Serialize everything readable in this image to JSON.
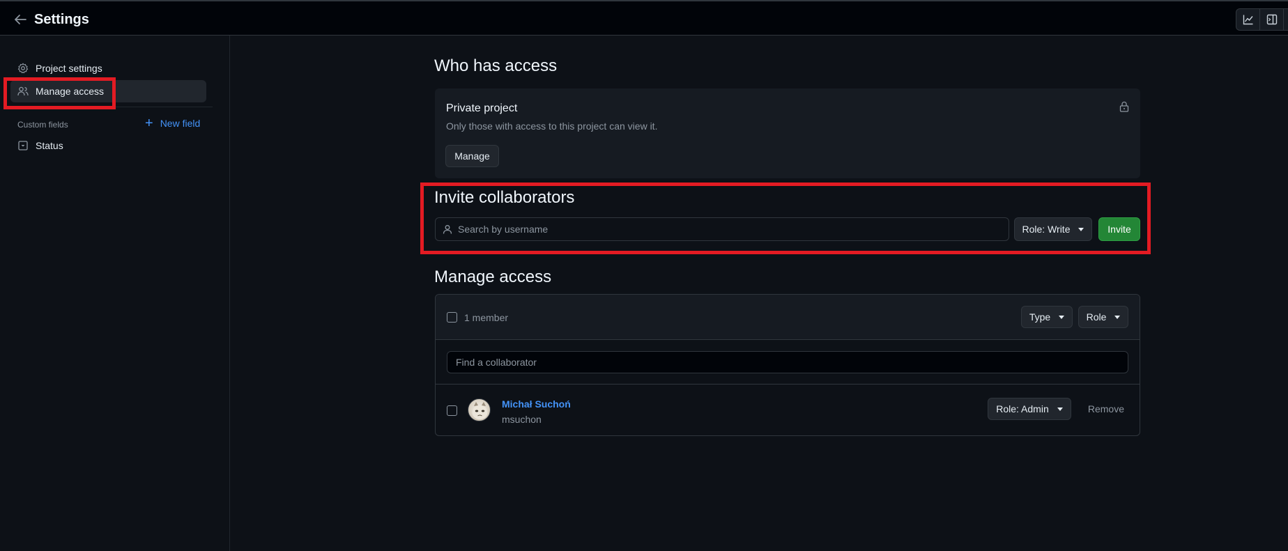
{
  "header": {
    "title": "Settings",
    "back_icon": "arrow-left-icon",
    "actions": [
      {
        "icon": "graph-icon"
      },
      {
        "icon": "sidebar-expand-icon"
      }
    ]
  },
  "sidebar": {
    "items": [
      {
        "label": "Project settings",
        "icon": "gear-icon",
        "active": false
      },
      {
        "label": "Manage access",
        "icon": "people-icon",
        "active": true
      }
    ],
    "custom_fields_label": "Custom fields",
    "new_field_label": "New field",
    "custom_fields": [
      {
        "label": "Status",
        "icon": "single-select-icon"
      }
    ]
  },
  "who_has_access": {
    "heading": "Who has access",
    "visibility_title": "Private project",
    "visibility_desc": "Only those with access to this project can view it.",
    "manage_label": "Manage"
  },
  "invite": {
    "heading": "Invite collaborators",
    "search_placeholder": "Search by username",
    "role_label": "Role: Write",
    "invite_label": "Invite"
  },
  "manage_access": {
    "heading": "Manage access",
    "member_count": "1 member",
    "type_filter": "Type",
    "role_filter": "Role",
    "find_placeholder": "Find a collaborator",
    "members": [
      {
        "name": "Michał Suchoń",
        "login": "msuchon",
        "role": "Role: Admin",
        "remove_label": "Remove"
      }
    ]
  },
  "colors": {
    "accent": "#4493f8",
    "highlight": "#e31b23",
    "invite_green": "#238636"
  }
}
